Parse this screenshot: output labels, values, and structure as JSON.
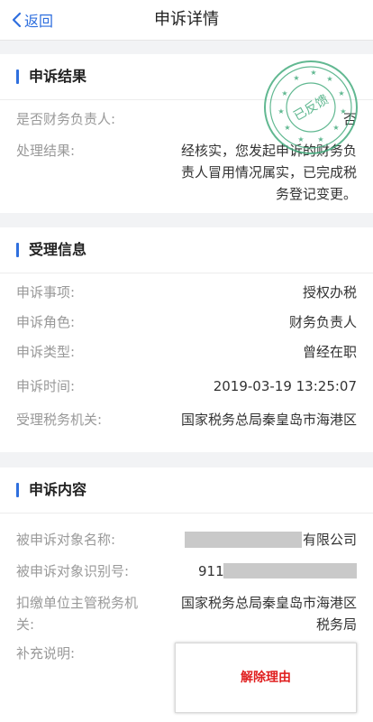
{
  "nav": {
    "back_label": "返回",
    "title": "申诉详情"
  },
  "result": {
    "section_title": "申诉结果",
    "is_finance_label": "是否财务负责人:",
    "is_finance_value": "否",
    "process_label": "处理结果:",
    "process_lines": [
      "经核实，您发起申诉的财务负",
      "责人冒用情况属实，已完成税",
      "务登记变更。"
    ],
    "stamp_text": "已反馈"
  },
  "acceptance": {
    "section_title": "受理信息",
    "rows": [
      {
        "label": "申诉事项:",
        "value": "授权办税"
      },
      {
        "label": "申诉角色:",
        "value": "财务负责人"
      },
      {
        "label": "申诉类型:",
        "value": "曾经在职"
      },
      {
        "label": "申诉时间:",
        "value": "2019-03-19 13:25:07"
      },
      {
        "label": "受理税务机关:",
        "value": "国家税务总局秦皇岛市海港区"
      }
    ]
  },
  "content": {
    "section_title": "申诉内容",
    "target_name_label": "被申诉对象名称:",
    "target_name_value": "有限公司",
    "target_id_label": "被申诉对象识别号:",
    "target_id_value": "911",
    "authority_label_line1": "扣缴单位主管税务机",
    "authority_label_line2": "关:",
    "authority_value_line1": "国家税务总局秦皇岛市海港区",
    "authority_value_line2": "税务局",
    "supplement_label": "补充说明:",
    "reason_button": "解除理由"
  },
  "colors": {
    "accent": "#2f6fde",
    "stamp": "#3aa776",
    "warning": "#e02020"
  }
}
